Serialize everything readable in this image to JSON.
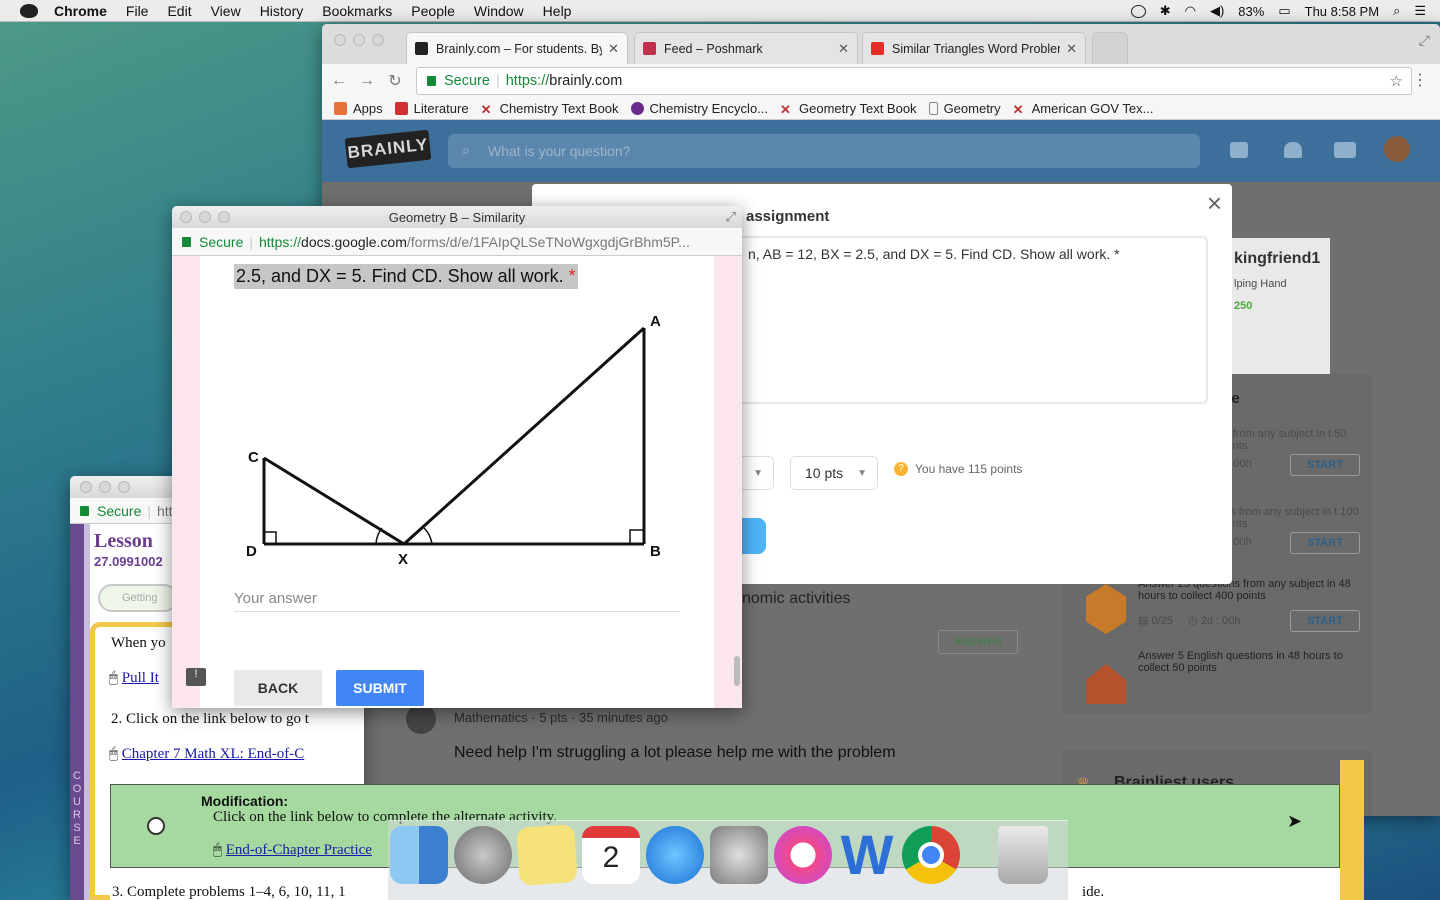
{
  "menubar": {
    "app": "Chrome",
    "menus": [
      "File",
      "Edit",
      "View",
      "History",
      "Bookmarks",
      "People",
      "Window",
      "Help"
    ],
    "battery": "83%",
    "clock": "Thu 8:58 PM"
  },
  "chrome": {
    "tabs": [
      {
        "title": "Brainly.com – For students. By students.",
        "active": true
      },
      {
        "title": "Feed – Poshmark"
      },
      {
        "title": "Similar Triangles Word Problem"
      }
    ],
    "url_secure": "Secure",
    "url_scheme": "https://",
    "url_host": "brainly.com",
    "bookmarks": [
      "Apps",
      "Literature",
      "Chemistry Text Book",
      "Chemistry Encyclo...",
      "Geometry Text Book",
      "Geometry",
      "American GOV Tex..."
    ]
  },
  "brainly": {
    "logo": "BRAINLY",
    "search_placeholder": "What is your question?",
    "modal": {
      "title": "assignment",
      "question": "n, AB = 12, BX = 2.5, and DX = 5. Find CD. Show all work. *",
      "points": "10 pts",
      "you_have": "You have 115 points"
    },
    "profile": {
      "name": "kingfriend1",
      "rank": "lping Hand",
      "points": "250"
    },
    "challenges": {
      "heading": "ete",
      "items": [
        {
          "text": "ns from any subject in t 50 points",
          "time": "d : 00h",
          "action": "START"
        },
        {
          "text": "ons from any subject in t 100 points",
          "time": "d : 00h",
          "action": "START"
        },
        {
          "text": "Answer 25 questions from any subject in 48 hours to collect 400 points",
          "progress": "0/25",
          "time": "2d : 00h",
          "action": "START"
        },
        {
          "text": "Answer 5 English questions in 48 hours to collect 50 points",
          "progress": "0/5",
          "time": "2d : 00h",
          "action": "START"
        }
      ]
    },
    "brainliest": "Brainliest users",
    "feed": {
      "snippet": "nomic activities",
      "answer_btn": "ANSWER",
      "meta": "Mathematics · 5 pts · 35 minutes ago",
      "question": "Need help I'm struggling a lot please help me with the problem"
    }
  },
  "gforms": {
    "title": "Geometry B – Similarity",
    "secure": "Secure",
    "url_scheme": "https://",
    "url_host": "docs.google.com",
    "url_path": "/forms/d/e/1FAIpQLSeTNoWgxgdjGrBhm5P...",
    "question": "2.5, and DX = 5. Find CD. Show all work.",
    "required": "*",
    "diagram_labels": {
      "a": "A",
      "b": "B",
      "c": "C",
      "d": "D",
      "x": "X"
    },
    "answer_placeholder": "Your answer",
    "back": "BACK",
    "submit": "SUBMIT",
    "feedback_icon": "!"
  },
  "lesson": {
    "secure": "Secure",
    "url": "htt",
    "heading": "Lesson",
    "code": "27.0991002",
    "getting": "Getting",
    "side_letters": [
      "C",
      "O",
      "U",
      "R",
      "S",
      "E"
    ],
    "line1": "When yo",
    "link1": "Pull It",
    "line2": "2. Click on the link below to go t",
    "link2": "Chapter 7 Math XL: End-of-C",
    "mod_title": "Modification:",
    "mod_text": "Click on the link below to complete the alternate activity.",
    "mod_link": "End-of-Chapter Practice",
    "line3": "3. Complete problems 1–4, 6, 10, 11, 1",
    "line3_end": "ide."
  }
}
